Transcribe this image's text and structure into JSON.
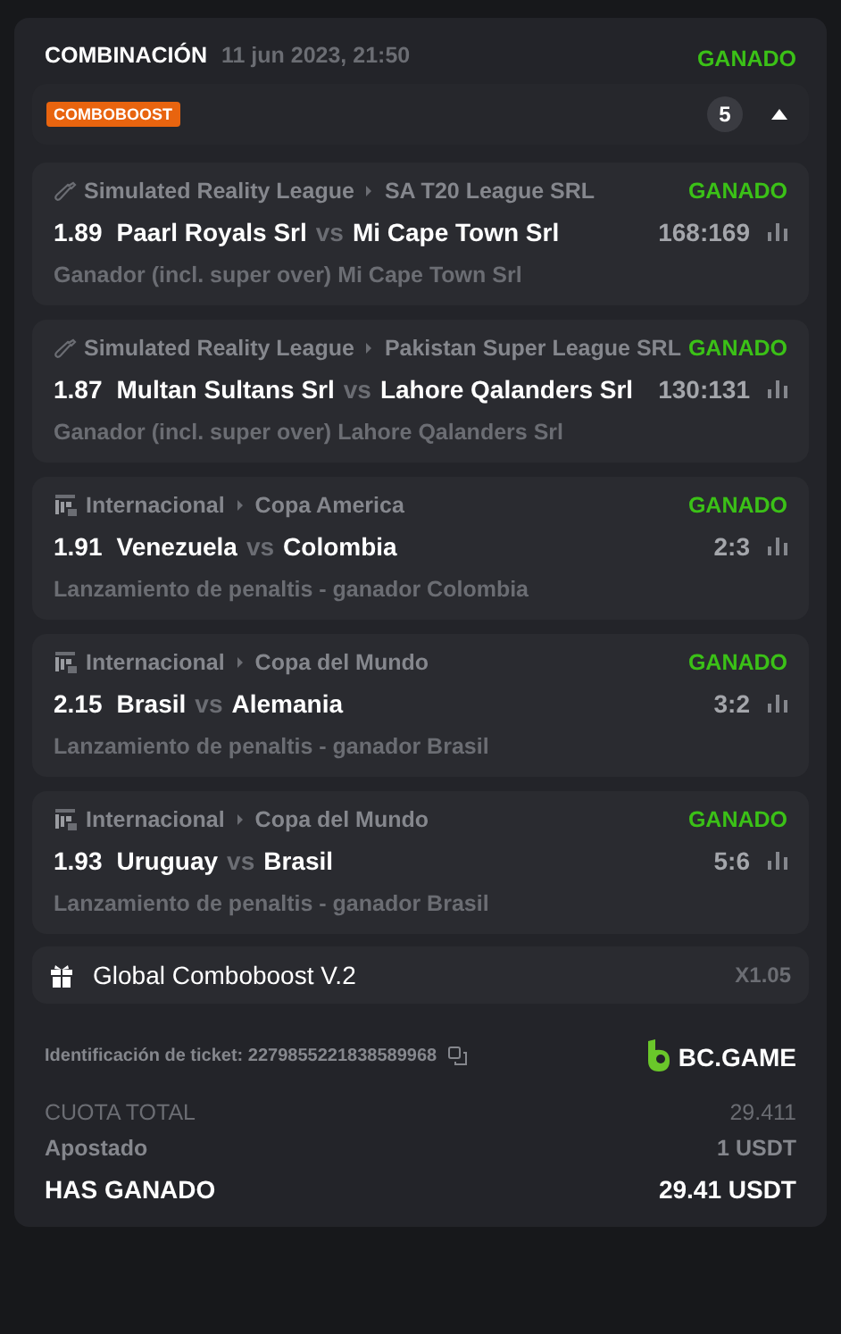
{
  "header": {
    "title": "COMBINACIÓN",
    "date": "11 jun 2023, 21:50",
    "status": "GANADO"
  },
  "combo_bar": {
    "badge": "COMBOBOOST",
    "count": "5",
    "expanded": true
  },
  "bets": [
    {
      "kind": "cricket",
      "league": "Simulated Reality League",
      "tournament": "SA T20 League SRL",
      "status": "GANADO",
      "odds": "1.89",
      "home": "Paarl Royals Srl",
      "vs": "vs",
      "away": "Mi Cape Town Srl",
      "score": "168:169",
      "market": "Ganador (incl. super over) Mi Cape Town Srl"
    },
    {
      "kind": "cricket",
      "league": "Simulated Reality League",
      "tournament": "Pakistan Super League SRL",
      "status": "GANADO",
      "odds": "1.87",
      "home": "Multan Sultans Srl",
      "vs": "vs",
      "away": "Lahore Qalanders Srl",
      "score": "130:131",
      "market": "Ganador (incl. super over) Lahore Qalanders Srl"
    },
    {
      "kind": "penalty",
      "league": "Internacional",
      "tournament": "Copa America",
      "status": "GANADO",
      "odds": "1.91",
      "home": "Venezuela",
      "vs": "vs",
      "away": "Colombia",
      "score": "2:3",
      "market": "Lanzamiento de penaltis - ganador Colombia"
    },
    {
      "kind": "penalty",
      "league": "Internacional",
      "tournament": "Copa del Mundo",
      "status": "GANADO",
      "odds": "2.15",
      "home": "Brasil",
      "vs": "vs",
      "away": "Alemania",
      "score": "3:2",
      "market": "Lanzamiento de penaltis - ganador Brasil"
    },
    {
      "kind": "penalty",
      "league": "Internacional",
      "tournament": "Copa del Mundo",
      "status": "GANADO",
      "odds": "1.93",
      "home": "Uruguay",
      "vs": "vs",
      "away": "Brasil",
      "score": "5:6",
      "market": "Lanzamiento de penaltis - ganador Brasil"
    }
  ],
  "boost": {
    "label": "Global Comboboost V.2",
    "multiplier": "X1.05"
  },
  "ticket": {
    "label": "Identificación de ticket: 2279855221838589968",
    "brand": "BC.GAME"
  },
  "totals": [
    {
      "kind": "muted",
      "label": "CUOTA TOTAL",
      "value": "29.411"
    },
    {
      "kind": "normal",
      "label": "Apostado",
      "value": "1 USDT"
    },
    {
      "kind": "strong",
      "label": "HAS GANADO",
      "value": "29.41 USDT"
    }
  ]
}
